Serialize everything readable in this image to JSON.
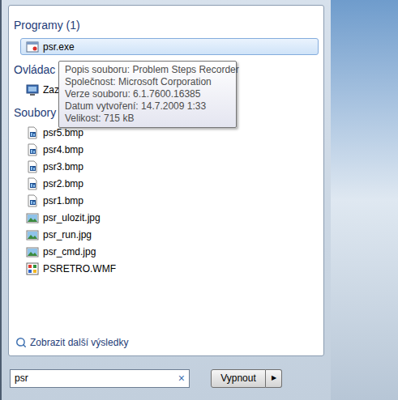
{
  "sections": [
    {
      "title": "Programy (1)",
      "items": [
        {
          "label": "psr.exe",
          "kind": "exe",
          "selected": true
        }
      ]
    },
    {
      "title": "Ovládac",
      "items": [
        {
          "label": "Zazn",
          "kind": "control",
          "selected": false
        }
      ]
    },
    {
      "title": "Soubory",
      "items": [
        {
          "label": "psr5.bmp",
          "kind": "bmp",
          "selected": false
        },
        {
          "label": "psr4.bmp",
          "kind": "bmp",
          "selected": false
        },
        {
          "label": "psr3.bmp",
          "kind": "bmp",
          "selected": false
        },
        {
          "label": "psr2.bmp",
          "kind": "bmp",
          "selected": false
        },
        {
          "label": "psr1.bmp",
          "kind": "bmp",
          "selected": false
        },
        {
          "label": "psr_ulozit.jpg",
          "kind": "jpg",
          "selected": false
        },
        {
          "label": "psr_run.jpg",
          "kind": "jpg",
          "selected": false
        },
        {
          "label": "psr_cmd.jpg",
          "kind": "jpg",
          "selected": false
        },
        {
          "label": "PSRETRO.WMF",
          "kind": "wmf",
          "selected": false
        }
      ]
    }
  ],
  "tooltip": {
    "lines": [
      "Popis souboru: Problem Steps Recorder",
      "Společnost: Microsoft Corporation",
      "Verze souboru: 6.1.7600.16385",
      "Datum vytvoření: 14.7.2009 1:33",
      "Velikost: 715 kB"
    ]
  },
  "more_results": "Zobrazit další výsledky",
  "search": {
    "value": "psr",
    "clear": "×"
  },
  "shutdown": {
    "label": "Vypnout",
    "arrow": "▶"
  }
}
